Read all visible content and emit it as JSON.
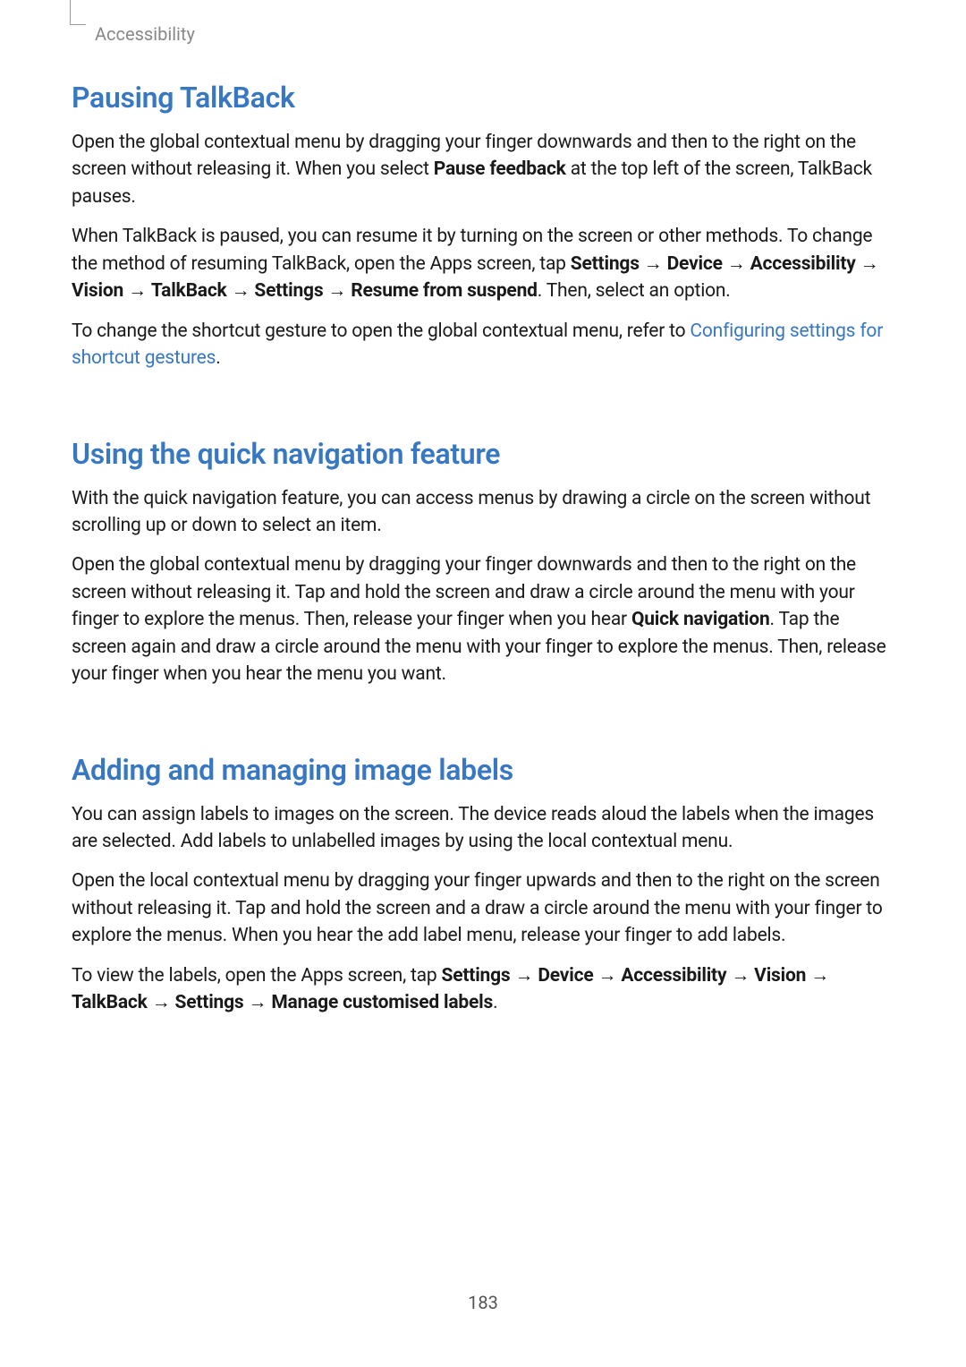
{
  "header": {
    "label": "Accessibility"
  },
  "section1": {
    "heading": "Pausing TalkBack",
    "p1_pre": "Open the global contextual menu by dragging your finger downwards and then to the right on the screen without releasing it. When you select ",
    "p1_bold": "Pause feedback",
    "p1_post": " at the top left of the screen, TalkBack pauses.",
    "p2_pre": "When TalkBack is paused, you can resume it by turning on the screen or other methods. To change the method of resuming TalkBack, open the Apps screen, tap ",
    "p2_b1": "Settings",
    "p2_arr1": " → ",
    "p2_b2": "Device",
    "p2_arr2": " → ",
    "p2_b3": "Accessibility",
    "p2_arr3": " → ",
    "p2_b4": "Vision",
    "p2_arr4": " → ",
    "p2_b5": "TalkBack",
    "p2_arr5": " → ",
    "p2_b6": "Settings",
    "p2_arr6": " → ",
    "p2_b7": "Resume from suspend",
    "p2_post": ". Then, select an option.",
    "p3_pre": "To change the shortcut gesture to open the global contextual menu, refer to ",
    "p3_link": "Configuring settings for shortcut gestures",
    "p3_post": "."
  },
  "section2": {
    "heading": "Using the quick navigation feature",
    "p1": "With the quick navigation feature, you can access menus by drawing a circle on the screen without scrolling up or down to select an item.",
    "p2_pre": "Open the global contextual menu by dragging your finger downwards and then to the right on the screen without releasing it. Tap and hold the screen and draw a circle around the menu with your finger to explore the menus. Then, release your finger when you hear ",
    "p2_bold": "Quick navigation",
    "p2_post": ". Tap the screen again and draw a circle around the menu with your finger to explore the menus. Then, release your finger when you hear the menu you want."
  },
  "section3": {
    "heading": "Adding and managing image labels",
    "p1": "You can assign labels to images on the screen. The device reads aloud the labels when the images are selected. Add labels to unlabelled images by using the local contextual menu.",
    "p2": "Open the local contextual menu by dragging your finger upwards and then to the right on the screen without releasing it. Tap and hold the screen and a draw a circle around the menu with your finger to explore the menus. When you hear the add label menu, release your finger to add labels.",
    "p3_pre": "To view the labels, open the Apps screen, tap ",
    "p3_b1": "Settings",
    "p3_arr1": " → ",
    "p3_b2": "Device",
    "p3_arr2": " → ",
    "p3_b3": "Accessibility",
    "p3_arr3": " → ",
    "p3_b4": "Vision",
    "p3_arr4": " → ",
    "p3_b5": "TalkBack",
    "p3_arr5": " → ",
    "p3_b6": "Settings",
    "p3_arr6": " → ",
    "p3_b7": "Manage customised labels",
    "p3_post": "."
  },
  "pageNumber": "183"
}
